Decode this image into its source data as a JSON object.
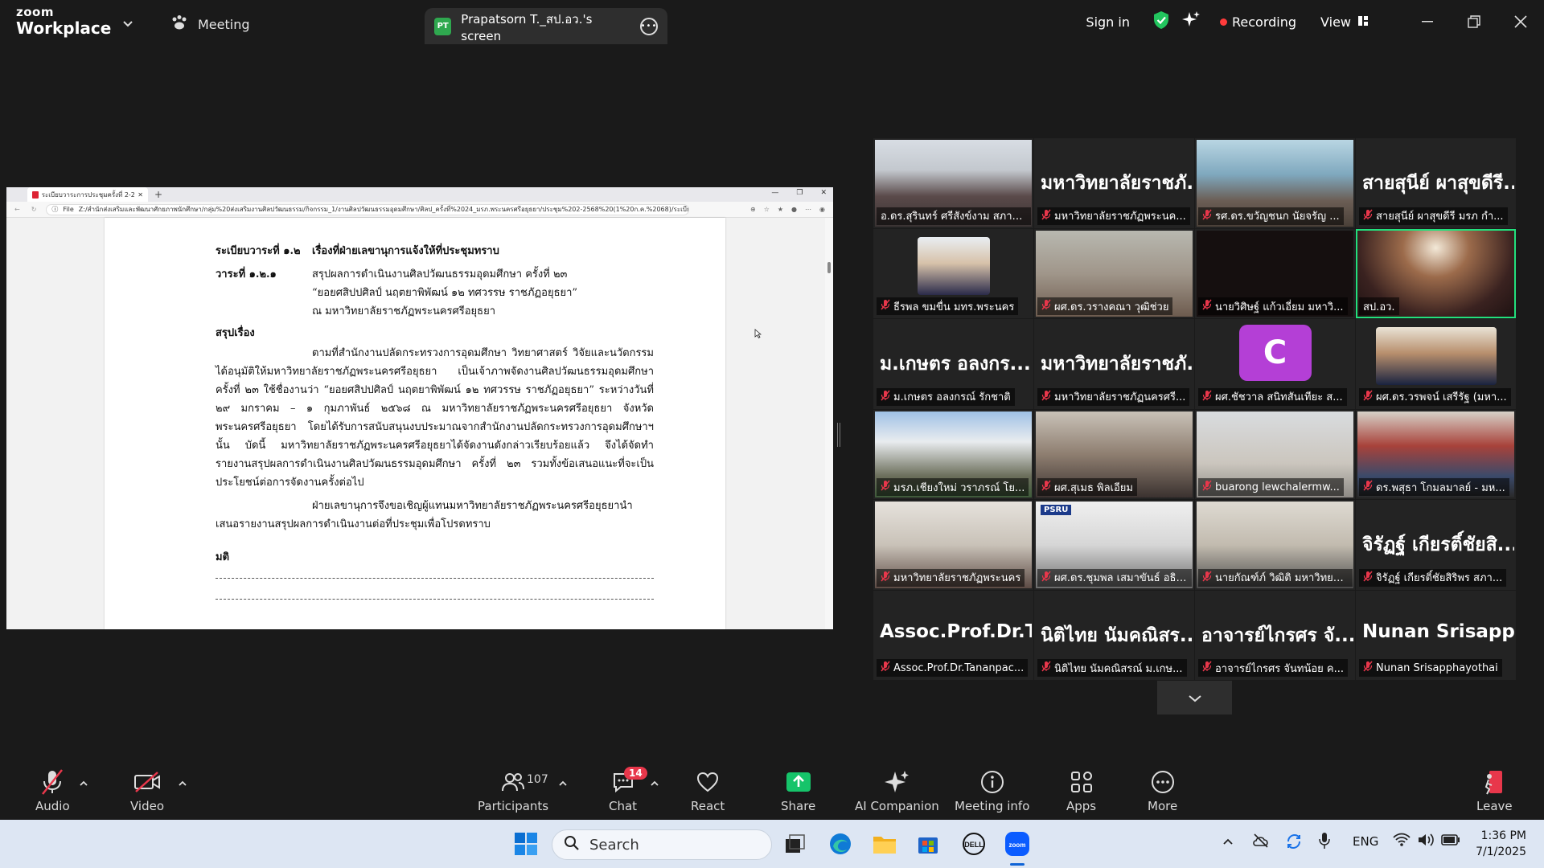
{
  "app": {
    "brand_top": "zoom",
    "brand_bottom": "Workplace",
    "meeting_tab": "Meeting",
    "share_badge": "PT",
    "share_tab": "Prapatsorn T._สป.อว.'s screen"
  },
  "topbar": {
    "signin": "Sign in",
    "recording": "Recording",
    "view": "View",
    "shield_color": "#22c55e",
    "recording_color": "#ff3b3b"
  },
  "browser": {
    "tab_title": "ระเบียบวาระการประชุมครั้งที่ 2-2568.pdf",
    "url_label": "File",
    "url": "Z:/สำนักส่งเสริมและพัฒนาศักยภาพนักศึกษา/กลุ่ม%20ส่งเสริมงานศิลปวัฒนธรรม/กิจกรรม_1/งานศิลปวัฒนธรรมอุดมศึกษา/ศิลป_ครั้งที่%2024_มรภ.พระนครศรีอยุธยา/ประชุม%202-2568%20(1%20ก.ค.%2068)/ระเบียบวาระการประชุมครั้งที่%202-256"
  },
  "document": {
    "agenda_head_k": "ระเบียบวาระที่ ๑.๒",
    "agenda_head_v": "เรื่องที่ฝ่ายเลขานุการแจ้งให้ที่ประชุมทราบ",
    "item_k": "วาระที่ ๑.๒.๑",
    "item_v1": "สรุปผลการดำเนินงานศิลปวัฒนธรรมอุดมศึกษา ครั้งที่ ๒๓",
    "item_v2": "“ยอยศสิปปศิลป์ นฤตยาพิพัฒน์ ๑๒ ทศวรรษ ราชภัฏอยุธยา”",
    "item_v3": "ณ มหาวิทยาลัยราชภัฏพระนครศรีอยุธยา",
    "summary_head": "สรุปเรื่อง",
    "para1": "ตามที่สำนักงานปลัดกระทรวงการอุดมศึกษา วิทยาศาสตร์ วิจัยและนวัตกรรม ได้อนุมัติให้มหาวิทยาลัยราชภัฏพระนครศรีอยุธยา เป็นเจ้าภาพจัดงานศิลปวัฒนธรรมอุดมศึกษา ครั้งที่ ๒๓ ใช้ชื่องานว่า “ยอยศสิปปศิลป์ นฤตยาพิพัฒน์ ๑๒ ทศวรรษ ราชภัฏอยุธยา” ระหว่างวันที่ ๒๙ มกราคม – ๑ กุมภาพันธ์ ๒๕๖๘ ณ มหาวิทยาลัยราชภัฏพระนครศรีอยุธยา จังหวัดพระนครศรีอยุธยา โดยได้รับการสนับสนุนงบประมาณจากสำนักงานปลัดกระทรวงการอุดมศึกษาฯ นั้น บัดนี้ มหาวิทยาลัยราชภัฏพระนครศรีอยุธยาได้จัดงานดังกล่าวเรียบร้อยแล้ว จึงได้จัดทำรายงานสรุปผลการดำเนินงานศิลปวัฒนธรรมอุดมศึกษา ครั้งที่ ๒๓ รวมทั้งข้อเสนอแนะที่จะเป็นประโยชน์ต่อการจัดงานครั้งต่อไป",
    "para2": "ฝ่ายเลขานุการจึงขอเชิญผู้แทนมหาวิทยาลัยราชภัฏพระนครศรีอยุธยานำเสนอรายงานสรุปผลการดำเนินงานต่อที่ประชุมเพื่อโปรดทราบ",
    "resolution": "มติ"
  },
  "gallery": {
    "accent": "#22e07d",
    "tiles": [
      {
        "label": "อ.ดร.สุรินทร์ ศรีสังข์งาม สภาบั...",
        "big": "",
        "muted": false
      },
      {
        "label": "มหาวิทยาลัยราชภัฏพระนค...",
        "big": "มหาวิทยาลัยราชภั...",
        "muted": true
      },
      {
        "label": "รศ.ดร.ขวัญชนก นัยจรัญ ...",
        "big": "",
        "muted": true
      },
      {
        "label": "สายสุนีย์ ผาสุขดีรี มรภ กำ...",
        "big": "สายสุนีย์ ผาสุขดีรี...",
        "muted": true
      },
      {
        "label": "ธีรพล ขมขื่น มทร.พระนคร",
        "big": "",
        "muted": true
      },
      {
        "label": "ผศ.ดร.วรางคณา วุฒิช่วย",
        "big": "",
        "muted": true
      },
      {
        "label": "นายวิศิษฐ์ แก้วเอี่ยม มหาวิ...",
        "big": "",
        "muted": true
      },
      {
        "label": "สป.อว.",
        "big": "",
        "muted": false
      },
      {
        "label": "ม.เกษตร อลงกรณ์ รักชาติ",
        "big": "ม.เกษตร อลงกร...",
        "muted": true
      },
      {
        "label": "มหาวิทยาลัยราชภัฏนครศรี...",
        "big": "มหาวิทยาลัยราชภั...",
        "muted": true
      },
      {
        "label": "ผศ.ชัชวาล สนิทสันเทียะ ส...",
        "big": "",
        "muted": true,
        "avatar": "C"
      },
      {
        "label": "ผศ.ดร.วรพจน์ เสรีรัฐ (มหา...",
        "big": "",
        "muted": true
      },
      {
        "label": "มรภ.เชียงใหม่ วราภรณ์ โย...",
        "big": "",
        "muted": true
      },
      {
        "label": "ผศ.สุเมธ พิลเอียม",
        "big": "",
        "muted": true
      },
      {
        "label": "buarong lewchalermw...",
        "big": "",
        "muted": true
      },
      {
        "label": "ดร.พสุธา โกมลมาลย์ - มห...",
        "big": "",
        "muted": true
      },
      {
        "label": "มหาวิทยาลัยราชภัฏพระนคร",
        "big": "",
        "muted": true
      },
      {
        "label": "ผศ.ดร.ชุมพล เสมาขันธ์ อธิกา...",
        "big": "",
        "muted": true,
        "sign": "PSRU"
      },
      {
        "label": "นายกัณฑ์ภ์ วิฒิติ มหาวิทยาลั...",
        "big": "",
        "muted": true
      },
      {
        "label": "จิรัฏฐ์ เกียรติ์ชัยสิริพร สภา...",
        "big": "จิรัฏฐ์ เกียรติ์ชัยสิ...",
        "muted": true
      },
      {
        "label": "Assoc.Prof.Dr.Tananpac...",
        "big": "Assoc.Prof.Dr.Ta...",
        "muted": true
      },
      {
        "label": "นิติไทย นัมคณิสรณ์ ม.เกษ...",
        "big": "นิติไทย นัมคณิสร...",
        "muted": true
      },
      {
        "label": "อาจารย์ไกรศร จันทน้อย ค...",
        "big": "อาจารย์ไกรศร จั...",
        "muted": true
      },
      {
        "label": "Nunan Srisapphayothai",
        "big": "Nunan Srisapph...",
        "muted": true
      }
    ]
  },
  "toolbar": {
    "audio": "Audio",
    "video": "Video",
    "participants": "Participants",
    "participants_count": "107",
    "chat": "Chat",
    "chat_badge": "14",
    "react": "React",
    "share": "Share",
    "ai": "AI Companion",
    "info": "Meeting info",
    "apps": "Apps",
    "more": "More",
    "leave": "Leave",
    "share_color": "#16c46a",
    "leave_color": "#e8374b"
  },
  "taskbar": {
    "search": "Search",
    "lang": "ENG",
    "time": "1:36 PM",
    "date": "7/1/2025"
  }
}
